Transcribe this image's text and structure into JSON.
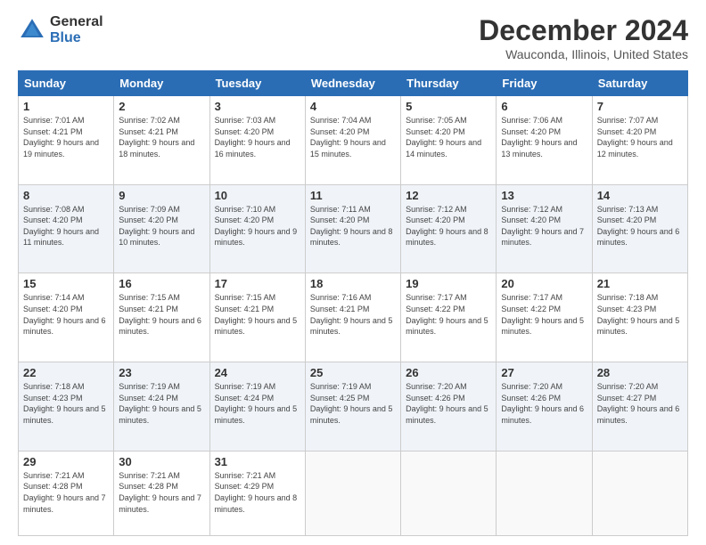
{
  "header": {
    "logo_general": "General",
    "logo_blue": "Blue",
    "title": "December 2024",
    "location": "Wauconda, Illinois, United States"
  },
  "days_of_week": [
    "Sunday",
    "Monday",
    "Tuesday",
    "Wednesday",
    "Thursday",
    "Friday",
    "Saturday"
  ],
  "weeks": [
    [
      {
        "day": "1",
        "sunrise": "Sunrise: 7:01 AM",
        "sunset": "Sunset: 4:21 PM",
        "daylight": "Daylight: 9 hours and 19 minutes."
      },
      {
        "day": "2",
        "sunrise": "Sunrise: 7:02 AM",
        "sunset": "Sunset: 4:21 PM",
        "daylight": "Daylight: 9 hours and 18 minutes."
      },
      {
        "day": "3",
        "sunrise": "Sunrise: 7:03 AM",
        "sunset": "Sunset: 4:20 PM",
        "daylight": "Daylight: 9 hours and 16 minutes."
      },
      {
        "day": "4",
        "sunrise": "Sunrise: 7:04 AM",
        "sunset": "Sunset: 4:20 PM",
        "daylight": "Daylight: 9 hours and 15 minutes."
      },
      {
        "day": "5",
        "sunrise": "Sunrise: 7:05 AM",
        "sunset": "Sunset: 4:20 PM",
        "daylight": "Daylight: 9 hours and 14 minutes."
      },
      {
        "day": "6",
        "sunrise": "Sunrise: 7:06 AM",
        "sunset": "Sunset: 4:20 PM",
        "daylight": "Daylight: 9 hours and 13 minutes."
      },
      {
        "day": "7",
        "sunrise": "Sunrise: 7:07 AM",
        "sunset": "Sunset: 4:20 PM",
        "daylight": "Daylight: 9 hours and 12 minutes."
      }
    ],
    [
      {
        "day": "8",
        "sunrise": "Sunrise: 7:08 AM",
        "sunset": "Sunset: 4:20 PM",
        "daylight": "Daylight: 9 hours and 11 minutes."
      },
      {
        "day": "9",
        "sunrise": "Sunrise: 7:09 AM",
        "sunset": "Sunset: 4:20 PM",
        "daylight": "Daylight: 9 hours and 10 minutes."
      },
      {
        "day": "10",
        "sunrise": "Sunrise: 7:10 AM",
        "sunset": "Sunset: 4:20 PM",
        "daylight": "Daylight: 9 hours and 9 minutes."
      },
      {
        "day": "11",
        "sunrise": "Sunrise: 7:11 AM",
        "sunset": "Sunset: 4:20 PM",
        "daylight": "Daylight: 9 hours and 8 minutes."
      },
      {
        "day": "12",
        "sunrise": "Sunrise: 7:12 AM",
        "sunset": "Sunset: 4:20 PM",
        "daylight": "Daylight: 9 hours and 8 minutes."
      },
      {
        "day": "13",
        "sunrise": "Sunrise: 7:12 AM",
        "sunset": "Sunset: 4:20 PM",
        "daylight": "Daylight: 9 hours and 7 minutes."
      },
      {
        "day": "14",
        "sunrise": "Sunrise: 7:13 AM",
        "sunset": "Sunset: 4:20 PM",
        "daylight": "Daylight: 9 hours and 6 minutes."
      }
    ],
    [
      {
        "day": "15",
        "sunrise": "Sunrise: 7:14 AM",
        "sunset": "Sunset: 4:20 PM",
        "daylight": "Daylight: 9 hours and 6 minutes."
      },
      {
        "day": "16",
        "sunrise": "Sunrise: 7:15 AM",
        "sunset": "Sunset: 4:21 PM",
        "daylight": "Daylight: 9 hours and 6 minutes."
      },
      {
        "day": "17",
        "sunrise": "Sunrise: 7:15 AM",
        "sunset": "Sunset: 4:21 PM",
        "daylight": "Daylight: 9 hours and 5 minutes."
      },
      {
        "day": "18",
        "sunrise": "Sunrise: 7:16 AM",
        "sunset": "Sunset: 4:21 PM",
        "daylight": "Daylight: 9 hours and 5 minutes."
      },
      {
        "day": "19",
        "sunrise": "Sunrise: 7:17 AM",
        "sunset": "Sunset: 4:22 PM",
        "daylight": "Daylight: 9 hours and 5 minutes."
      },
      {
        "day": "20",
        "sunrise": "Sunrise: 7:17 AM",
        "sunset": "Sunset: 4:22 PM",
        "daylight": "Daylight: 9 hours and 5 minutes."
      },
      {
        "day": "21",
        "sunrise": "Sunrise: 7:18 AM",
        "sunset": "Sunset: 4:23 PM",
        "daylight": "Daylight: 9 hours and 5 minutes."
      }
    ],
    [
      {
        "day": "22",
        "sunrise": "Sunrise: 7:18 AM",
        "sunset": "Sunset: 4:23 PM",
        "daylight": "Daylight: 9 hours and 5 minutes."
      },
      {
        "day": "23",
        "sunrise": "Sunrise: 7:19 AM",
        "sunset": "Sunset: 4:24 PM",
        "daylight": "Daylight: 9 hours and 5 minutes."
      },
      {
        "day": "24",
        "sunrise": "Sunrise: 7:19 AM",
        "sunset": "Sunset: 4:24 PM",
        "daylight": "Daylight: 9 hours and 5 minutes."
      },
      {
        "day": "25",
        "sunrise": "Sunrise: 7:19 AM",
        "sunset": "Sunset: 4:25 PM",
        "daylight": "Daylight: 9 hours and 5 minutes."
      },
      {
        "day": "26",
        "sunrise": "Sunrise: 7:20 AM",
        "sunset": "Sunset: 4:26 PM",
        "daylight": "Daylight: 9 hours and 5 minutes."
      },
      {
        "day": "27",
        "sunrise": "Sunrise: 7:20 AM",
        "sunset": "Sunset: 4:26 PM",
        "daylight": "Daylight: 9 hours and 6 minutes."
      },
      {
        "day": "28",
        "sunrise": "Sunrise: 7:20 AM",
        "sunset": "Sunset: 4:27 PM",
        "daylight": "Daylight: 9 hours and 6 minutes."
      }
    ],
    [
      {
        "day": "29",
        "sunrise": "Sunrise: 7:21 AM",
        "sunset": "Sunset: 4:28 PM",
        "daylight": "Daylight: 9 hours and 7 minutes."
      },
      {
        "day": "30",
        "sunrise": "Sunrise: 7:21 AM",
        "sunset": "Sunset: 4:28 PM",
        "daylight": "Daylight: 9 hours and 7 minutes."
      },
      {
        "day": "31",
        "sunrise": "Sunrise: 7:21 AM",
        "sunset": "Sunset: 4:29 PM",
        "daylight": "Daylight: 9 hours and 8 minutes."
      },
      null,
      null,
      null,
      null
    ]
  ]
}
